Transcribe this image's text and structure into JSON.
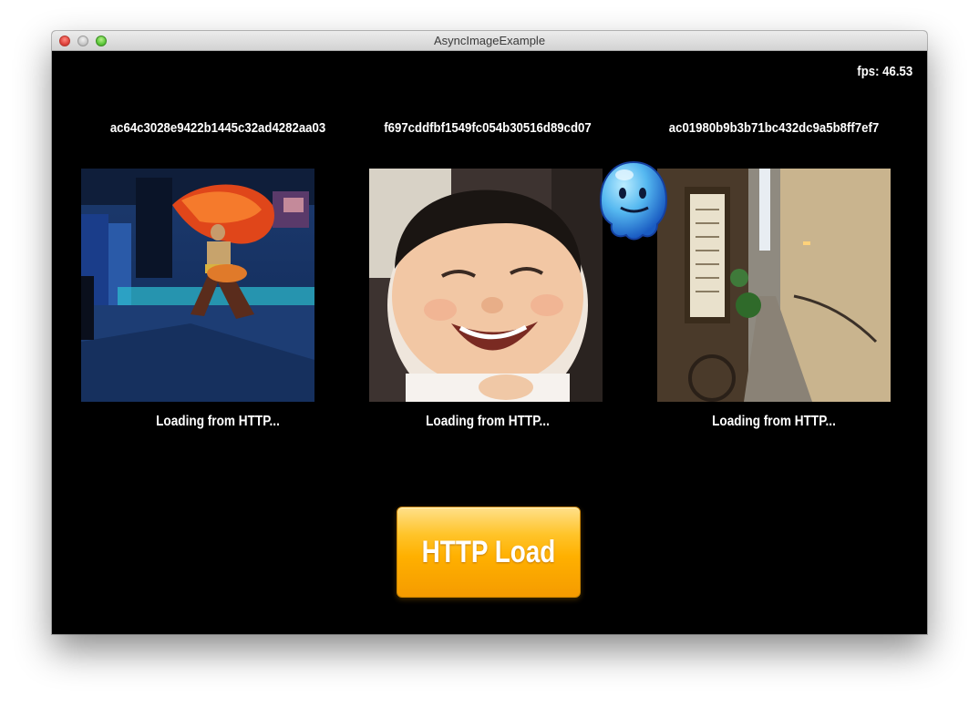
{
  "window": {
    "title": "AsyncImageExample"
  },
  "fps": "fps: 46.53",
  "images": [
    {
      "hash": "ac64c3028e9422b1445c32ad4282aa03",
      "status": "Loading from HTTP...",
      "subject": "dancer with red fan on stage"
    },
    {
      "hash": "f697cddfbf1549fc054b30516d89cd07",
      "status": "Loading from HTTP...",
      "subject": "laughing baby"
    },
    {
      "hash": "ac01980b9b3b71bc432dc9a5b8ff7ef7",
      "status": "Loading from HTTP...",
      "subject": "narrow stone alley with sign"
    }
  ],
  "button": {
    "label": "HTTP Load"
  },
  "icons": {
    "close": "close-icon",
    "minimize": "minimize-icon",
    "maximize": "maximize-icon",
    "mascot": "blue-blob-mascot-icon"
  },
  "colors": {
    "background": "#000000",
    "button_top": "#ffe08a",
    "button_bottom": "#f59b00",
    "text": "#ffffff"
  }
}
